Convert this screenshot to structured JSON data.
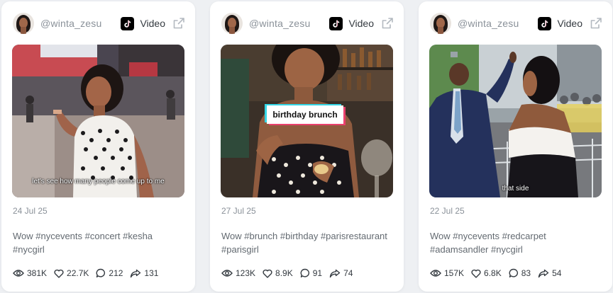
{
  "cards": [
    {
      "handle": "@winta_zesu",
      "platform_label": "Video",
      "caption": "let's see how many people come up to me",
      "sticker": "",
      "date": "24 Jul 25",
      "description": "Wow #nycevents #concert #kesha #nycgirl",
      "views": "381K",
      "likes": "22.7K",
      "comments": "212",
      "shares": "131"
    },
    {
      "handle": "@winta_zesu",
      "platform_label": "Video",
      "caption": "",
      "sticker": "birthday brunch",
      "date": "27 Jul 25",
      "description": "Wow #brunch #birthday #parisrestaurant #parisgirl",
      "views": "123K",
      "likes": "8.9K",
      "comments": "91",
      "shares": "74"
    },
    {
      "handle": "@winta_zesu",
      "platform_label": "Video",
      "caption": "that side",
      "sticker": "",
      "date": "22 Jul 25",
      "description": "Wow #nycevents #redcarpet #adamsandler #nycgirl",
      "views": "157K",
      "likes": "6.8K",
      "comments": "83",
      "shares": "54"
    }
  ],
  "icons": {
    "platform": "tiktok-icon",
    "external": "external-link-icon",
    "views": "eye-icon",
    "likes": "heart-icon",
    "comments": "comment-icon",
    "shares": "share-icon"
  },
  "colors": {
    "page_bg": "#eef0f3",
    "card_bg": "#ffffff",
    "muted_text": "#8a9199",
    "body_text": "#636a71",
    "dark_text": "#343a40",
    "tiktok_cyan": "#35d7e7",
    "tiktok_pink": "#ea3f6d"
  }
}
